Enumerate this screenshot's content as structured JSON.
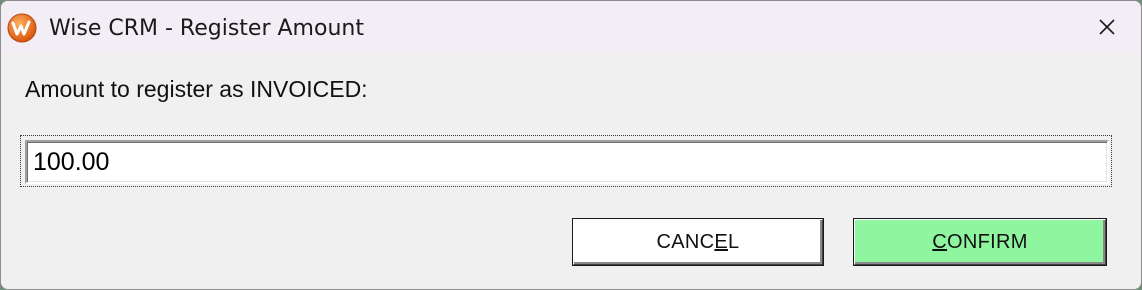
{
  "window": {
    "title": "Wise CRM - Register Amount",
    "app_icon": "wise-crm-logo-icon",
    "close_icon": "close-icon"
  },
  "dialog": {
    "prompt": "Amount to register as INVOICED:",
    "amount_value": "100.00",
    "cancel": {
      "before": "CANC",
      "accel": "E",
      "after": "L"
    },
    "confirm": {
      "before": "",
      "accel": "C",
      "after": "ONFIRM"
    }
  },
  "colors": {
    "confirm_button_bg": "#8ff59f",
    "cancel_button_bg": "#ffffff",
    "titlebar_bg": "#f3eef6",
    "dialog_bg": "#f0f0f0",
    "app_icon": "#e8701a"
  }
}
